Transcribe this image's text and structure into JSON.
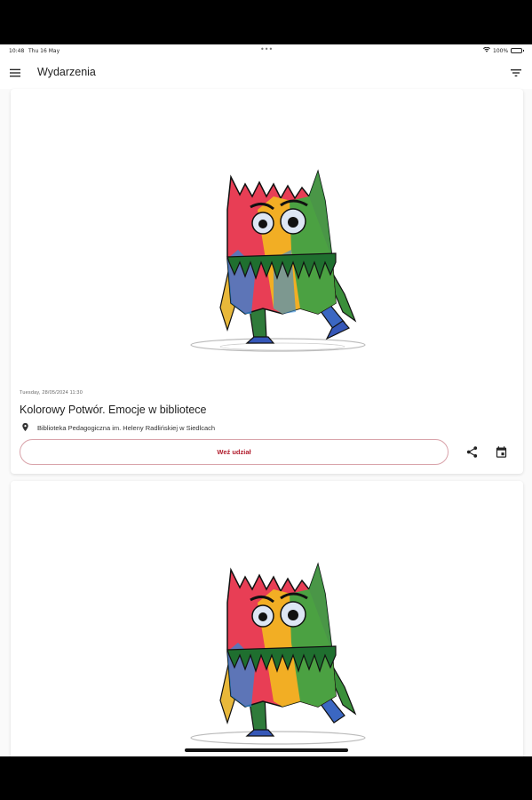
{
  "status_bar": {
    "time": "10:48",
    "date": "Thu 16 May",
    "dots": "•••",
    "battery_percent": "100%"
  },
  "app_bar": {
    "title": "Wydarzenia",
    "menu_icon": "hamburger-menu-icon",
    "filter_icon": "filter-icon"
  },
  "events": [
    {
      "datetime": "Tuesday, 28/05/2024 11:30",
      "title": "Kolorowy Potwór. Emocje w bibliotece",
      "place": "Biblioteka Pedagogiczna im. Heleny Radlińskiej w Siedlcach",
      "join_label": "Weź udział"
    }
  ],
  "colors": {
    "accent": "#b11d2d",
    "button_border": "#d9a3aa",
    "background": "#fafafa",
    "card": "#ffffff"
  }
}
